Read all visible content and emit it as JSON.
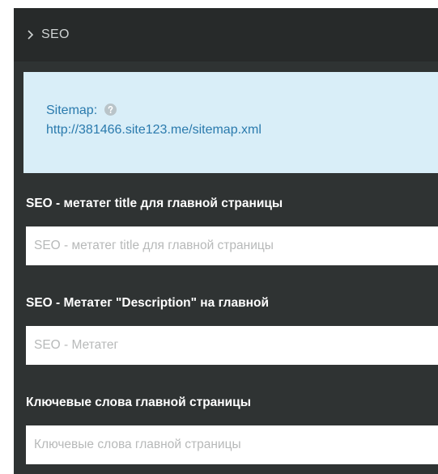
{
  "section": {
    "title": "SEO",
    "toggle_icon": "chevron-right-icon"
  },
  "sitemap": {
    "label": "Sitemap:",
    "help_icon": "question-circle-icon",
    "url": "http://381466.site123.me/sitemap.xml"
  },
  "fields": [
    {
      "label": "SEO - метатег title для главной страницы",
      "value": "",
      "placeholder": "SEO - метатег title для главной страницы"
    },
    {
      "label": "SEO - Метатег \"Description\" на главной",
      "value": "",
      "placeholder": "SEO - Метатег"
    },
    {
      "label": "Ключевые слова главной страницы",
      "value": "",
      "placeholder": "Ключевые слова главной страницы"
    }
  ],
  "colors": {
    "panel_background": "#2f3333",
    "header_background": "#272a2a",
    "info_background": "#d9eef8",
    "info_text": "#2a7aad",
    "label_text": "#ffffff",
    "placeholder_text": "#b7b9b9"
  }
}
